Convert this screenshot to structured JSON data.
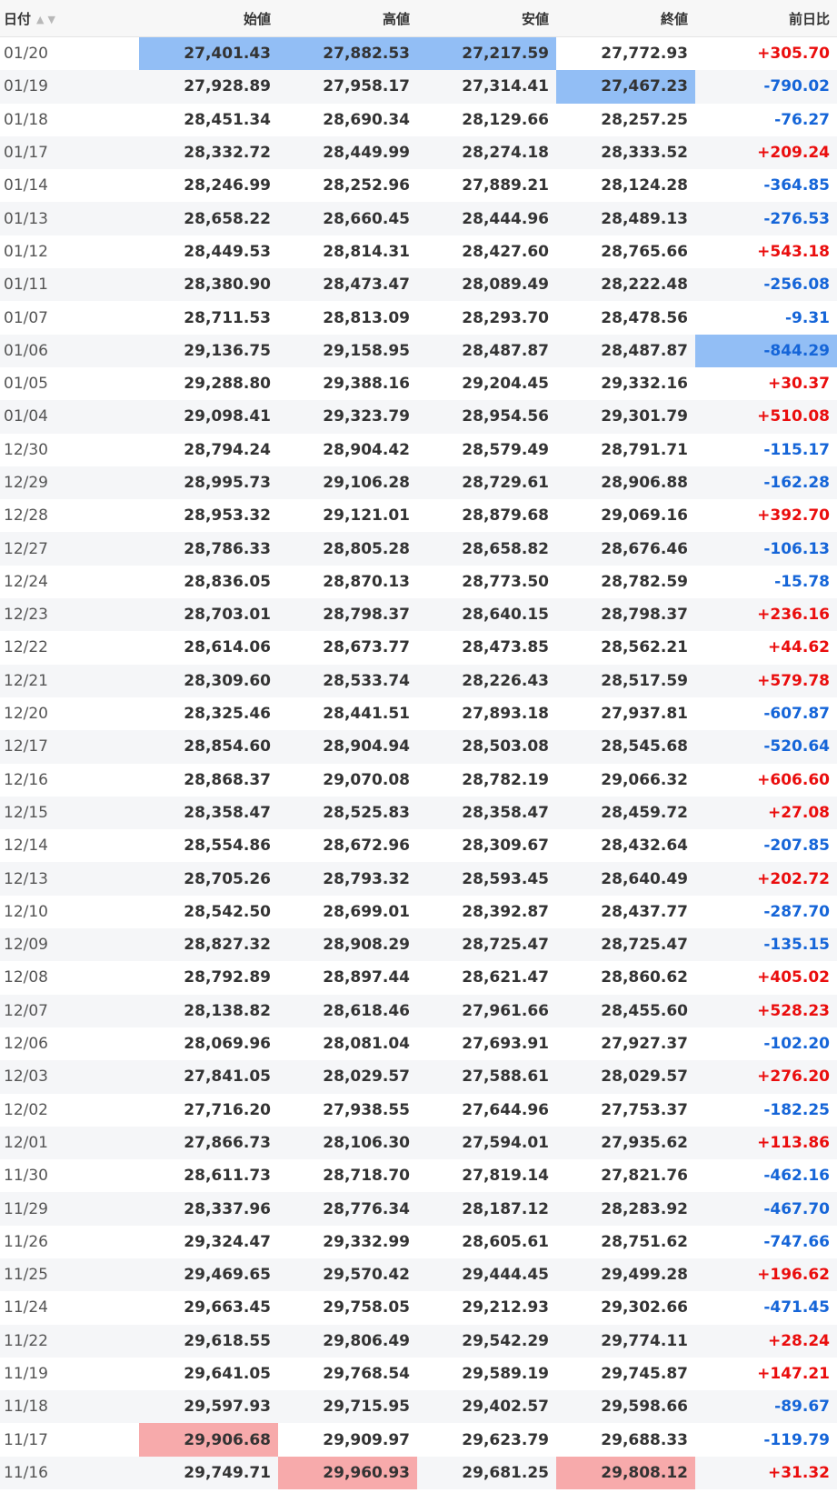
{
  "headers": [
    "日付",
    "始値",
    "高値",
    "安値",
    "終値",
    "前日比"
  ],
  "sort_icons": {
    "up": "sort-ascending-icon",
    "down": "sort-descending-icon"
  },
  "colors": {
    "positive": "#ea0d0d",
    "negative": "#1565d8",
    "highlight_blue": "#92bef5",
    "highlight_red": "#f7aaab",
    "row_alt": "#f5f6f8"
  },
  "rows": [
    [
      "01/20",
      "27,401.43",
      "27,882.53",
      "27,217.59",
      "27,772.93",
      "+305.70"
    ],
    [
      "01/19",
      "27,928.89",
      "27,958.17",
      "27,314.41",
      "27,467.23",
      "-790.02"
    ],
    [
      "01/18",
      "28,451.34",
      "28,690.34",
      "28,129.66",
      "28,257.25",
      "-76.27"
    ],
    [
      "01/17",
      "28,332.72",
      "28,449.99",
      "28,274.18",
      "28,333.52",
      "+209.24"
    ],
    [
      "01/14",
      "28,246.99",
      "28,252.96",
      "27,889.21",
      "28,124.28",
      "-364.85"
    ],
    [
      "01/13",
      "28,658.22",
      "28,660.45",
      "28,444.96",
      "28,489.13",
      "-276.53"
    ],
    [
      "01/12",
      "28,449.53",
      "28,814.31",
      "28,427.60",
      "28,765.66",
      "+543.18"
    ],
    [
      "01/11",
      "28,380.90",
      "28,473.47",
      "28,089.49",
      "28,222.48",
      "-256.08"
    ],
    [
      "01/07",
      "28,711.53",
      "28,813.09",
      "28,293.70",
      "28,478.56",
      "-9.31"
    ],
    [
      "01/06",
      "29,136.75",
      "29,158.95",
      "28,487.87",
      "28,487.87",
      "-844.29"
    ],
    [
      "01/05",
      "29,288.80",
      "29,388.16",
      "29,204.45",
      "29,332.16",
      "+30.37"
    ],
    [
      "01/04",
      "29,098.41",
      "29,323.79",
      "28,954.56",
      "29,301.79",
      "+510.08"
    ],
    [
      "12/30",
      "28,794.24",
      "28,904.42",
      "28,579.49",
      "28,791.71",
      "-115.17"
    ],
    [
      "12/29",
      "28,995.73",
      "29,106.28",
      "28,729.61",
      "28,906.88",
      "-162.28"
    ],
    [
      "12/28",
      "28,953.32",
      "29,121.01",
      "28,879.68",
      "29,069.16",
      "+392.70"
    ],
    [
      "12/27",
      "28,786.33",
      "28,805.28",
      "28,658.82",
      "28,676.46",
      "-106.13"
    ],
    [
      "12/24",
      "28,836.05",
      "28,870.13",
      "28,773.50",
      "28,782.59",
      "-15.78"
    ],
    [
      "12/23",
      "28,703.01",
      "28,798.37",
      "28,640.15",
      "28,798.37",
      "+236.16"
    ],
    [
      "12/22",
      "28,614.06",
      "28,673.77",
      "28,473.85",
      "28,562.21",
      "+44.62"
    ],
    [
      "12/21",
      "28,309.60",
      "28,533.74",
      "28,226.43",
      "28,517.59",
      "+579.78"
    ],
    [
      "12/20",
      "28,325.46",
      "28,441.51",
      "27,893.18",
      "27,937.81",
      "-607.87"
    ],
    [
      "12/17",
      "28,854.60",
      "28,904.94",
      "28,503.08",
      "28,545.68",
      "-520.64"
    ],
    [
      "12/16",
      "28,868.37",
      "29,070.08",
      "28,782.19",
      "29,066.32",
      "+606.60"
    ],
    [
      "12/15",
      "28,358.47",
      "28,525.83",
      "28,358.47",
      "28,459.72",
      "+27.08"
    ],
    [
      "12/14",
      "28,554.86",
      "28,672.96",
      "28,309.67",
      "28,432.64",
      "-207.85"
    ],
    [
      "12/13",
      "28,705.26",
      "28,793.32",
      "28,593.45",
      "28,640.49",
      "+202.72"
    ],
    [
      "12/10",
      "28,542.50",
      "28,699.01",
      "28,392.87",
      "28,437.77",
      "-287.70"
    ],
    [
      "12/09",
      "28,827.32",
      "28,908.29",
      "28,725.47",
      "28,725.47",
      "-135.15"
    ],
    [
      "12/08",
      "28,792.89",
      "28,897.44",
      "28,621.47",
      "28,860.62",
      "+405.02"
    ],
    [
      "12/07",
      "28,138.82",
      "28,618.46",
      "27,961.66",
      "28,455.60",
      "+528.23"
    ],
    [
      "12/06",
      "28,069.96",
      "28,081.04",
      "27,693.91",
      "27,927.37",
      "-102.20"
    ],
    [
      "12/03",
      "27,841.05",
      "28,029.57",
      "27,588.61",
      "28,029.57",
      "+276.20"
    ],
    [
      "12/02",
      "27,716.20",
      "27,938.55",
      "27,644.96",
      "27,753.37",
      "-182.25"
    ],
    [
      "12/01",
      "27,866.73",
      "28,106.30",
      "27,594.01",
      "27,935.62",
      "+113.86"
    ],
    [
      "11/30",
      "28,611.73",
      "28,718.70",
      "27,819.14",
      "27,821.76",
      "-462.16"
    ],
    [
      "11/29",
      "28,337.96",
      "28,776.34",
      "28,187.12",
      "28,283.92",
      "-467.70"
    ],
    [
      "11/26",
      "29,324.47",
      "29,332.99",
      "28,605.61",
      "28,751.62",
      "-747.66"
    ],
    [
      "11/25",
      "29,469.65",
      "29,570.42",
      "29,444.45",
      "29,499.28",
      "+196.62"
    ],
    [
      "11/24",
      "29,663.45",
      "29,758.05",
      "29,212.93",
      "29,302.66",
      "-471.45"
    ],
    [
      "11/22",
      "29,618.55",
      "29,806.49",
      "29,542.29",
      "29,774.11",
      "+28.24"
    ],
    [
      "11/19",
      "29,641.05",
      "29,768.54",
      "29,589.19",
      "29,745.87",
      "+147.21"
    ],
    [
      "11/18",
      "29,597.93",
      "29,715.95",
      "29,402.57",
      "29,598.66",
      "-89.67"
    ],
    [
      "11/17",
      "29,906.68",
      "29,909.97",
      "29,623.79",
      "29,688.33",
      "-119.79"
    ],
    [
      "11/16",
      "29,749.71",
      "29,960.93",
      "29,681.25",
      "29,808.12",
      "+31.32"
    ]
  ],
  "highlights": [
    {
      "row": 0,
      "col": 1,
      "tone": "blue"
    },
    {
      "row": 0,
      "col": 2,
      "tone": "blue"
    },
    {
      "row": 0,
      "col": 3,
      "tone": "blue"
    },
    {
      "row": 1,
      "col": 4,
      "tone": "blue"
    },
    {
      "row": 9,
      "col": 5,
      "tone": "blue"
    },
    {
      "row": 42,
      "col": 1,
      "tone": "red"
    },
    {
      "row": 43,
      "col": 2,
      "tone": "red"
    },
    {
      "row": 43,
      "col": 4,
      "tone": "red"
    }
  ]
}
